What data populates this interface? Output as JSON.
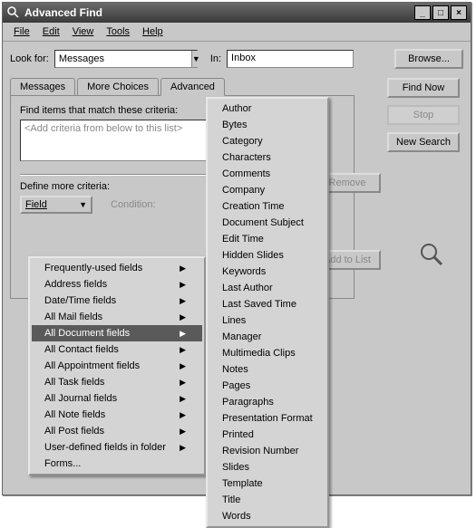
{
  "window": {
    "title": "Advanced Find"
  },
  "menubar": [
    "File",
    "Edit",
    "View",
    "Tools",
    "Help"
  ],
  "lookfor": {
    "label": "Look for:",
    "value": "Messages"
  },
  "in": {
    "label": "In:",
    "value": "Inbox"
  },
  "buttons": {
    "browse": "Browse...",
    "find_now": "Find Now",
    "stop": "Stop",
    "new_search": "New Search",
    "remove": "Remove",
    "add_to_list": "Add to List"
  },
  "tabs": [
    "Messages",
    "More Choices",
    "Advanced"
  ],
  "panel": {
    "caption": "Find items that match these criteria:",
    "placeholder": "<Add criteria from below to this list>"
  },
  "define": {
    "label": "Define more criteria:",
    "field_btn": "Field",
    "condition_label": "Condition:"
  },
  "menu1": [
    {
      "label": "Frequently-used fields",
      "sub": true
    },
    {
      "label": "Address fields",
      "sub": true
    },
    {
      "label": "Date/Time fields",
      "sub": true
    },
    {
      "label": "All Mail fields",
      "sub": true
    },
    {
      "label": "All Document fields",
      "sub": true,
      "selected": true
    },
    {
      "label": "All Contact fields",
      "sub": true
    },
    {
      "label": "All Appointment fields",
      "sub": true
    },
    {
      "label": "All Task fields",
      "sub": true
    },
    {
      "label": "All Journal fields",
      "sub": true
    },
    {
      "label": "All Note fields",
      "sub": true
    },
    {
      "label": "All Post fields",
      "sub": true
    },
    {
      "label": "User-defined fields in folder",
      "sub": true
    },
    {
      "label": "Forms...",
      "sub": false
    }
  ],
  "menu2": [
    "Author",
    "Bytes",
    "Category",
    "Characters",
    "Comments",
    "Company",
    "Creation Time",
    "Document Subject",
    "Edit Time",
    "Hidden Slides",
    "Keywords",
    "Last Author",
    "Last Saved Time",
    "Lines",
    "Manager",
    "Multimedia Clips",
    "Notes",
    "Pages",
    "Paragraphs",
    "Presentation Format",
    "Printed",
    "Revision Number",
    "Slides",
    "Template",
    "Title",
    "Words"
  ]
}
